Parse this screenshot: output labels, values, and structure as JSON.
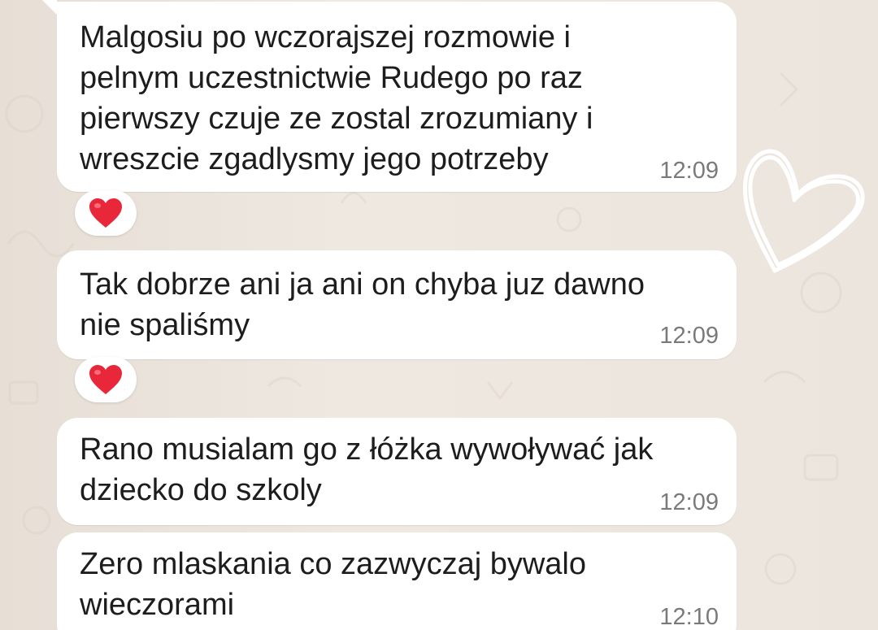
{
  "messages": [
    {
      "text": "Malgosiu po wczorajszej rozmowie i\npelnym uczestnictwie Rudego po raz\npierwszy czuje ze zostal zrozumiany i\nwreszcie zgadlysmy jego potrzeby",
      "time": "12:09",
      "reaction": "red-heart"
    },
    {
      "text": "Tak dobrze ani ja ani on chyba juz dawno\nnie spaliśmy",
      "time": "12:09",
      "reaction": "red-heart"
    },
    {
      "text": "Rano musialam go z łóżka wywoływać jak\ndziecko do szkoly",
      "time": "12:09",
      "reaction": null
    },
    {
      "text": "Zero mlaskania co zazwyczaj bywalo\nwieczorami",
      "time": "12:10",
      "reaction": null
    }
  ],
  "colors": {
    "bubble": "#ffffff",
    "timestamp": "#7a7a7a",
    "text": "#1d1d1d",
    "heart": "#e8283a",
    "deco_heart": "#ffffff"
  },
  "icons": {
    "reaction": "red-heart-icon",
    "decoration": "outline-heart-icon"
  }
}
